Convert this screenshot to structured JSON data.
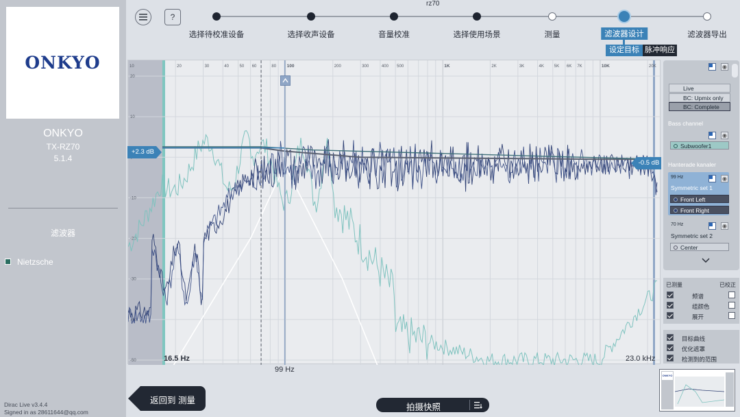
{
  "sidebar": {
    "logo": "ONKYO",
    "brand": "ONKYO",
    "model": "TX-RZ70",
    "config": "5.1.4",
    "section_title": "滤波器",
    "filter_name": "Nietzsche",
    "version": "Dirac Live v3.4.4",
    "signed_in": "Signed in as 28611644@qq.com"
  },
  "header": {
    "menu_icon": "hamburger-menu-icon",
    "help_label": "?",
    "project": "rz70"
  },
  "steps": [
    {
      "label": "选择待校准设备",
      "state": "done"
    },
    {
      "label": "选择收声设备",
      "state": "done"
    },
    {
      "label": "音量校准",
      "state": "done"
    },
    {
      "label": "选择使用场景",
      "state": "done"
    },
    {
      "label": "测量",
      "state": "todo"
    },
    {
      "label": "滤波器设计",
      "state": "current"
    },
    {
      "label": "滤波器导出",
      "state": "todo"
    }
  ],
  "subtabs": [
    {
      "label": "设定目标",
      "active": true
    },
    {
      "label": "脉冲响应",
      "active": false
    }
  ],
  "graph": {
    "freq_ticks": [
      "10",
      "20",
      "30",
      "40",
      "50",
      "60",
      "80",
      "100",
      "200",
      "300",
      "400",
      "500",
      "1K",
      "2K",
      "3K",
      "4K",
      "5K",
      "6K",
      "7K",
      "10K",
      "20K"
    ],
    "db_ticks": [
      "20",
      "10",
      "0",
      "-10",
      "-20",
      "-30",
      "-40",
      "-50"
    ],
    "left_handle": "+2.3 dB",
    "right_handle": "-0.5 dB",
    "low_limit": "16.5 Hz",
    "high_limit": "23.0 kHz",
    "crossover": "99 Hz"
  },
  "right_panel": {
    "modes": [
      "Live",
      "BC: Upmix only",
      "BC: Complete"
    ],
    "selected_mode": "BC: Complete",
    "bass_title": "Bass channel",
    "bass_channels": [
      "Subwoofer1"
    ],
    "group_title": "Hanterade kanaler",
    "groups": [
      {
        "freq": "99 Hz",
        "name": "Symmetric set 1",
        "channels": [
          "Front Left",
          "Front Right"
        ]
      },
      {
        "freq": "70 Hz",
        "name": "Symmetric set 2",
        "channels": [
          "Center"
        ]
      }
    ]
  },
  "view_options": {
    "measured_header": "已测量",
    "corrected_header": "已校正",
    "rows": [
      {
        "label": "频谱",
        "measured": true,
        "corrected": false
      },
      {
        "label": "组颜色",
        "measured": true,
        "corrected": false
      },
      {
        "label": "展开",
        "measured": true,
        "corrected": false
      }
    ],
    "extras": [
      {
        "label": "目标曲线",
        "checked": true
      },
      {
        "label": "优化遮罩",
        "checked": true
      },
      {
        "label": "检测到的范围",
        "checked": true
      }
    ]
  },
  "bottom": {
    "back_label": "返回到 测量",
    "snapshot_label": "拍摄快照"
  },
  "colors": {
    "accent": "#3b82b7",
    "measured_dark": "#2e3f72",
    "measured_light": "#7dc2be",
    "target": "#5a6070"
  }
}
